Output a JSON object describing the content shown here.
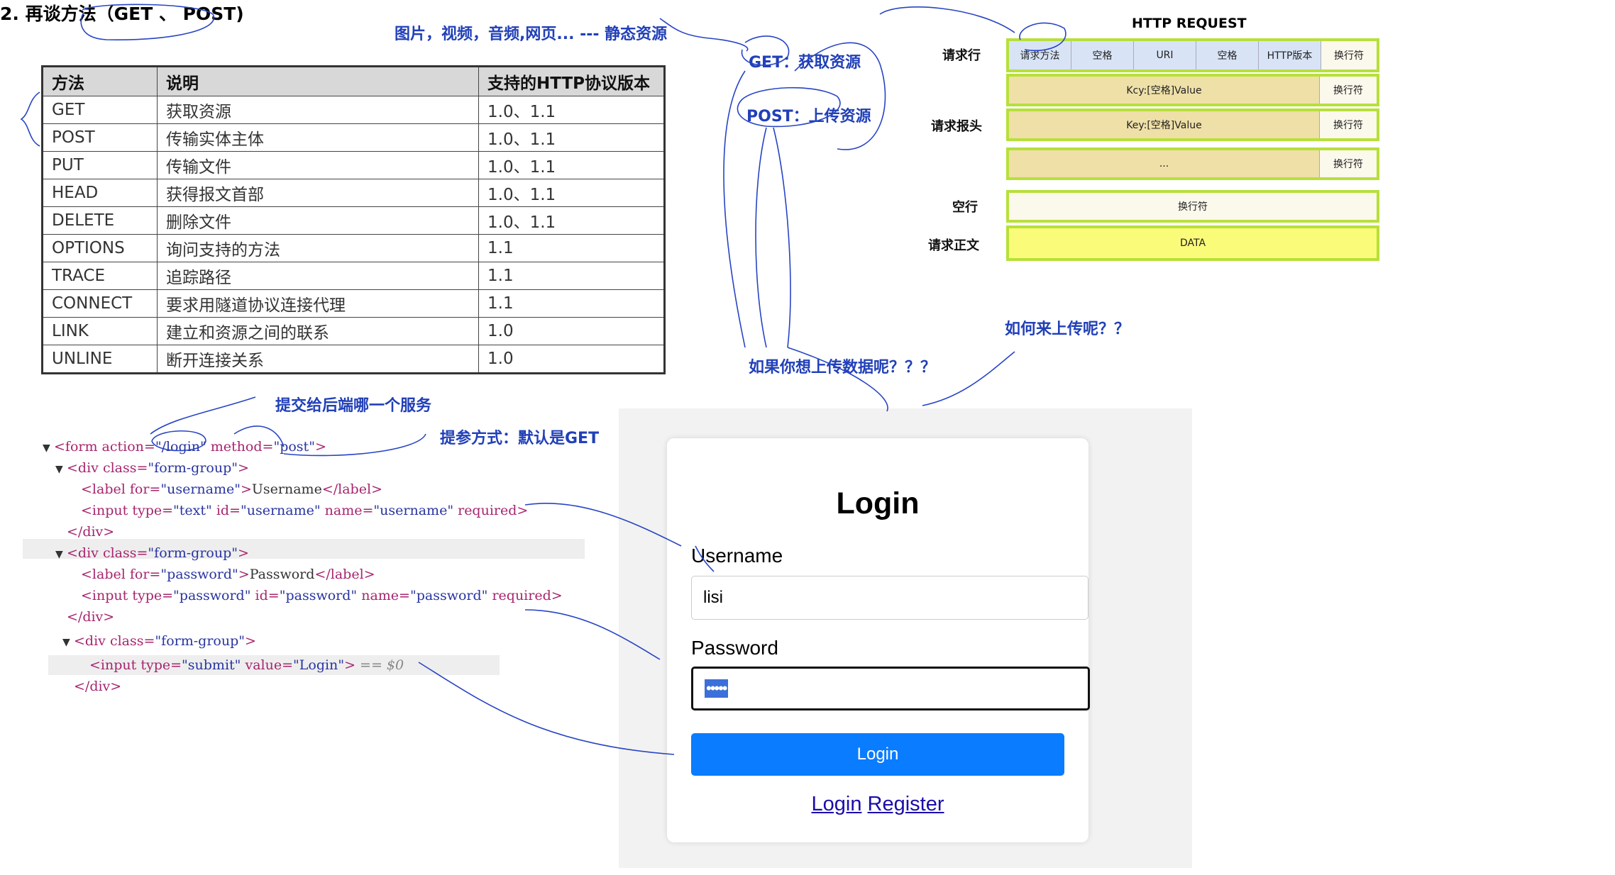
{
  "heading": "2. 再谈方法（GET 、 POST)",
  "methods_table": {
    "headers": [
      "方法",
      "说明",
      "支持的HTTP协议版本"
    ],
    "rows": [
      [
        "GET",
        "获取资源",
        "1.0、1.1"
      ],
      [
        "POST",
        "传输实体主体",
        "1.0、1.1"
      ],
      [
        "PUT",
        "传输文件",
        "1.0、1.1"
      ],
      [
        "HEAD",
        "获得报文首部",
        "1.0、1.1"
      ],
      [
        "DELETE",
        "删除文件",
        "1.0、1.1"
      ],
      [
        "OPTIONS",
        "询问支持的方法",
        "1.1"
      ],
      [
        "TRACE",
        "追踪路径",
        "1.1"
      ],
      [
        "CONNECT",
        "要求用隧道协议连接代理",
        "1.1"
      ],
      [
        "LINK",
        "建立和资源之间的联系",
        "1.0"
      ],
      [
        "UNLINE",
        "断开连接关系",
        "1.0"
      ]
    ]
  },
  "notes": {
    "static_resources": "图片，视频，音频,网页... --- 静态资源",
    "get_note": "GET：获取资源",
    "post_note": "POST：上传资源",
    "upload_question": "如果你想上传数据呢？？？",
    "how_upload": "如何来上传呢？？",
    "submit_target": "提交给后端哪一个服务",
    "param_method": "提参方式：默认是GET"
  },
  "http_request": {
    "title": "HTTP REQUEST",
    "labels": {
      "request_line": "请求行",
      "request_headers": "请求报头",
      "blank_line": "空行",
      "request_body": "请求正文"
    },
    "request_line_cells": [
      "请求方法",
      "空格",
      "URI",
      "空格",
      "HTTP版本",
      "换行符"
    ],
    "header_rows": [
      {
        "content": "Kcy:[空格]Value",
        "end": "换行符"
      },
      {
        "content": "Key:[空格]Value",
        "end": "换行符"
      },
      {
        "content": "...",
        "end": "换行符"
      }
    ],
    "blank_cell": "换行符",
    "body_cell": "DATA"
  },
  "code": {
    "form_open": {
      "tag": "form",
      "action": "/login",
      "method": "post"
    },
    "group_class": "form-group",
    "label_username": {
      "for": "username",
      "text": "Username"
    },
    "input_username": {
      "type": "text",
      "id": "username",
      "name": "username",
      "flag": "required"
    },
    "label_password": {
      "for": "password",
      "text": "Password"
    },
    "input_password": {
      "type": "password",
      "id": "password",
      "name": "password",
      "flag": "required"
    },
    "input_submit": {
      "type": "submit",
      "value": "Login",
      "eq": "== $0"
    }
  },
  "login_form": {
    "title": "Login",
    "username_label": "Username",
    "username_value": "lisi",
    "password_label": "Password",
    "password_mask": "•••••",
    "submit_label": "Login",
    "link_login": "Login",
    "link_register": "Register"
  },
  "colors": {
    "annotation": "#2140b8",
    "diagram_border": "#b7e03a",
    "login_button": "#0a7cff"
  }
}
